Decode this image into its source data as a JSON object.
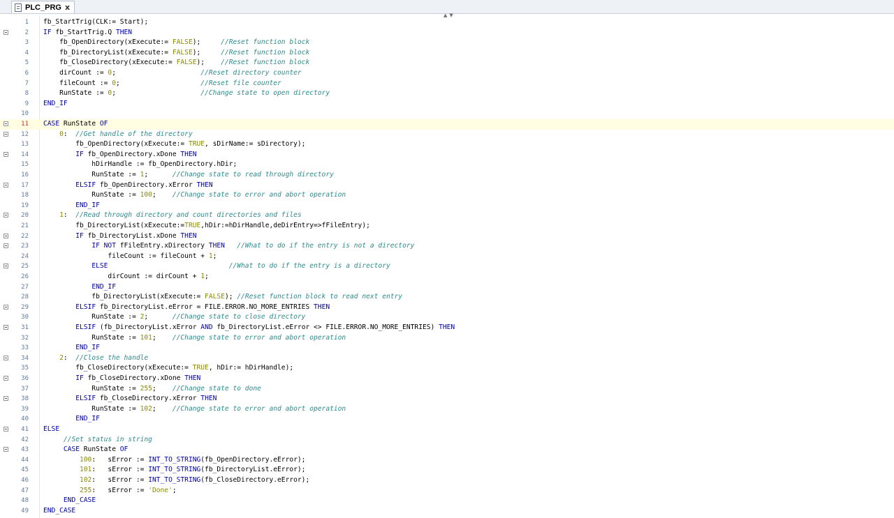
{
  "tab": {
    "label": "PLC_PRG",
    "close_label": "x"
  },
  "editor": {
    "active_line": 11,
    "lines": [
      {
        "n": "1",
        "fold": false,
        "tokens": [
          {
            "t": "fb_StartTrig(CLK:= Start);",
            "c": "txt"
          }
        ]
      },
      {
        "n": "2",
        "fold": true,
        "tokens": [
          {
            "t": "IF",
            "c": "kw"
          },
          {
            "t": " fb_StartTrig.Q ",
            "c": "txt"
          },
          {
            "t": "THEN",
            "c": "kw"
          }
        ]
      },
      {
        "n": "3",
        "fold": false,
        "tokens": [
          {
            "t": "    fb_OpenDirectory(xExecute:= ",
            "c": "txt"
          },
          {
            "t": "FALSE",
            "c": "num"
          },
          {
            "t": ");     ",
            "c": "txt"
          },
          {
            "t": "//Reset function block",
            "c": "cmt"
          }
        ]
      },
      {
        "n": "4",
        "fold": false,
        "tokens": [
          {
            "t": "    fb_DirectoryList(xExecute:= ",
            "c": "txt"
          },
          {
            "t": "FALSE",
            "c": "num"
          },
          {
            "t": ");     ",
            "c": "txt"
          },
          {
            "t": "//Reset function block",
            "c": "cmt"
          }
        ]
      },
      {
        "n": "5",
        "fold": false,
        "tokens": [
          {
            "t": "    fb_CloseDirectory(xExecute:= ",
            "c": "txt"
          },
          {
            "t": "FALSE",
            "c": "num"
          },
          {
            "t": ");    ",
            "c": "txt"
          },
          {
            "t": "//Reset function block",
            "c": "cmt"
          }
        ]
      },
      {
        "n": "6",
        "fold": false,
        "tokens": [
          {
            "t": "    dirCount := ",
            "c": "txt"
          },
          {
            "t": "0",
            "c": "num"
          },
          {
            "t": ";                     ",
            "c": "txt"
          },
          {
            "t": "//Reset directory counter",
            "c": "cmt"
          }
        ]
      },
      {
        "n": "7",
        "fold": false,
        "tokens": [
          {
            "t": "    fileCount := ",
            "c": "txt"
          },
          {
            "t": "0",
            "c": "num"
          },
          {
            "t": ";                    ",
            "c": "txt"
          },
          {
            "t": "//Reset file counter",
            "c": "cmt"
          }
        ]
      },
      {
        "n": "8",
        "fold": false,
        "tokens": [
          {
            "t": "    RunState := ",
            "c": "txt"
          },
          {
            "t": "0",
            "c": "num"
          },
          {
            "t": ";                     ",
            "c": "txt"
          },
          {
            "t": "//Change state to open directory",
            "c": "cmt"
          }
        ]
      },
      {
        "n": "9",
        "fold": false,
        "tokens": [
          {
            "t": "END_IF",
            "c": "kw"
          }
        ]
      },
      {
        "n": "10",
        "fold": false,
        "tokens": []
      },
      {
        "n": "11",
        "fold": true,
        "tokens": [
          {
            "t": "CASE",
            "c": "kw"
          },
          {
            "t": " RunState ",
            "c": "txt"
          },
          {
            "t": "OF",
            "c": "kw"
          }
        ]
      },
      {
        "n": "12",
        "fold": true,
        "tokens": [
          {
            "t": "    ",
            "c": "txt"
          },
          {
            "t": "0",
            "c": "num"
          },
          {
            "t": ":  ",
            "c": "txt"
          },
          {
            "t": "//Get handle of the directory",
            "c": "cmt"
          }
        ]
      },
      {
        "n": "13",
        "fold": false,
        "tokens": [
          {
            "t": "        fb_OpenDirectory(xExecute:= ",
            "c": "txt"
          },
          {
            "t": "TRUE",
            "c": "num"
          },
          {
            "t": ", sDirName:= sDirectory);",
            "c": "txt"
          }
        ]
      },
      {
        "n": "14",
        "fold": true,
        "tokens": [
          {
            "t": "        ",
            "c": "txt"
          },
          {
            "t": "IF",
            "c": "kw"
          },
          {
            "t": " fb_OpenDirectory.xDone ",
            "c": "txt"
          },
          {
            "t": "THEN",
            "c": "kw"
          }
        ]
      },
      {
        "n": "15",
        "fold": false,
        "tokens": [
          {
            "t": "            hDirHandle := fb_OpenDirectory.hDir;",
            "c": "txt"
          }
        ]
      },
      {
        "n": "16",
        "fold": false,
        "tokens": [
          {
            "t": "            RunState := ",
            "c": "txt"
          },
          {
            "t": "1",
            "c": "num"
          },
          {
            "t": ";      ",
            "c": "txt"
          },
          {
            "t": "//Change state to read through directory",
            "c": "cmt"
          }
        ]
      },
      {
        "n": "17",
        "fold": true,
        "tokens": [
          {
            "t": "        ",
            "c": "txt"
          },
          {
            "t": "ELSIF",
            "c": "kw"
          },
          {
            "t": " fb_OpenDirectory.xError ",
            "c": "txt"
          },
          {
            "t": "THEN",
            "c": "kw"
          }
        ]
      },
      {
        "n": "18",
        "fold": false,
        "tokens": [
          {
            "t": "            RunState := ",
            "c": "txt"
          },
          {
            "t": "100",
            "c": "num"
          },
          {
            "t": ";    ",
            "c": "txt"
          },
          {
            "t": "//Change state to error and abort operation",
            "c": "cmt"
          }
        ]
      },
      {
        "n": "19",
        "fold": false,
        "tokens": [
          {
            "t": "        ",
            "c": "txt"
          },
          {
            "t": "END_IF",
            "c": "kw"
          }
        ]
      },
      {
        "n": "20",
        "fold": true,
        "tokens": [
          {
            "t": "    ",
            "c": "txt"
          },
          {
            "t": "1",
            "c": "num"
          },
          {
            "t": ":  ",
            "c": "txt"
          },
          {
            "t": "//Read through directory and count directories and files",
            "c": "cmt"
          }
        ]
      },
      {
        "n": "21",
        "fold": false,
        "tokens": [
          {
            "t": "        fb_DirectoryList(xExecute:=",
            "c": "txt"
          },
          {
            "t": "TRUE",
            "c": "num"
          },
          {
            "t": ",hDir:=hDirHandle,deDirEntry=>fFileEntry);",
            "c": "txt"
          }
        ]
      },
      {
        "n": "22",
        "fold": true,
        "tokens": [
          {
            "t": "        ",
            "c": "txt"
          },
          {
            "t": "IF",
            "c": "kw"
          },
          {
            "t": " fb_DirectoryList.xDone ",
            "c": "txt"
          },
          {
            "t": "THEN",
            "c": "kw"
          }
        ]
      },
      {
        "n": "23",
        "fold": true,
        "tokens": [
          {
            "t": "            ",
            "c": "txt"
          },
          {
            "t": "IF NOT",
            "c": "kw"
          },
          {
            "t": " fFileEntry.xDirectory ",
            "c": "txt"
          },
          {
            "t": "THEN",
            "c": "kw"
          },
          {
            "t": "   ",
            "c": "txt"
          },
          {
            "t": "//What to do if the entry is not a directory",
            "c": "cmt"
          }
        ]
      },
      {
        "n": "24",
        "fold": false,
        "tokens": [
          {
            "t": "                fileCount := fileCount + ",
            "c": "txt"
          },
          {
            "t": "1",
            "c": "num"
          },
          {
            "t": ";",
            "c": "txt"
          }
        ]
      },
      {
        "n": "25",
        "fold": true,
        "tokens": [
          {
            "t": "            ",
            "c": "txt"
          },
          {
            "t": "ELSE",
            "c": "kw"
          },
          {
            "t": "                              ",
            "c": "txt"
          },
          {
            "t": "//What to do if the entry is a directory",
            "c": "cmt"
          }
        ]
      },
      {
        "n": "26",
        "fold": false,
        "tokens": [
          {
            "t": "                dirCount := dirCount + ",
            "c": "txt"
          },
          {
            "t": "1",
            "c": "num"
          },
          {
            "t": ";",
            "c": "txt"
          }
        ]
      },
      {
        "n": "27",
        "fold": false,
        "tokens": [
          {
            "t": "            ",
            "c": "txt"
          },
          {
            "t": "END_IF",
            "c": "kw"
          }
        ]
      },
      {
        "n": "28",
        "fold": false,
        "tokens": [
          {
            "t": "            fb_DirectoryList(xExecute:= ",
            "c": "txt"
          },
          {
            "t": "FALSE",
            "c": "num"
          },
          {
            "t": "); ",
            "c": "txt"
          },
          {
            "t": "//Reset function block to read next entry",
            "c": "cmt"
          }
        ]
      },
      {
        "n": "29",
        "fold": true,
        "tokens": [
          {
            "t": "        ",
            "c": "txt"
          },
          {
            "t": "ELSIF",
            "c": "kw"
          },
          {
            "t": " fb_DirectoryList.eError = FILE.ERROR.NO_MORE_ENTRIES ",
            "c": "txt"
          },
          {
            "t": "THEN",
            "c": "kw"
          }
        ]
      },
      {
        "n": "30",
        "fold": false,
        "tokens": [
          {
            "t": "            RunState := ",
            "c": "txt"
          },
          {
            "t": "2",
            "c": "num"
          },
          {
            "t": ";      ",
            "c": "txt"
          },
          {
            "t": "//Change state to close directory",
            "c": "cmt"
          }
        ]
      },
      {
        "n": "31",
        "fold": true,
        "tokens": [
          {
            "t": "        ",
            "c": "txt"
          },
          {
            "t": "ELSIF",
            "c": "kw"
          },
          {
            "t": " (fb_DirectoryList.xError ",
            "c": "txt"
          },
          {
            "t": "AND",
            "c": "kw"
          },
          {
            "t": " fb_DirectoryList.eError <> FILE.ERROR.NO_MORE_ENTRIES) ",
            "c": "txt"
          },
          {
            "t": "THEN",
            "c": "kw"
          }
        ]
      },
      {
        "n": "32",
        "fold": false,
        "tokens": [
          {
            "t": "            RunState := ",
            "c": "txt"
          },
          {
            "t": "101",
            "c": "num"
          },
          {
            "t": ";    ",
            "c": "txt"
          },
          {
            "t": "//Change state to error and abort operation",
            "c": "cmt"
          }
        ]
      },
      {
        "n": "33",
        "fold": false,
        "tokens": [
          {
            "t": "        ",
            "c": "txt"
          },
          {
            "t": "END_IF",
            "c": "kw"
          }
        ]
      },
      {
        "n": "34",
        "fold": true,
        "tokens": [
          {
            "t": "    ",
            "c": "txt"
          },
          {
            "t": "2",
            "c": "num"
          },
          {
            "t": ":  ",
            "c": "txt"
          },
          {
            "t": "//Close the handle",
            "c": "cmt"
          }
        ]
      },
      {
        "n": "35",
        "fold": false,
        "tokens": [
          {
            "t": "        fb_CloseDirectory(xExecute:= ",
            "c": "txt"
          },
          {
            "t": "TRUE",
            "c": "num"
          },
          {
            "t": ", hDir:= hDirHandle);",
            "c": "txt"
          }
        ]
      },
      {
        "n": "36",
        "fold": true,
        "tokens": [
          {
            "t": "        ",
            "c": "txt"
          },
          {
            "t": "IF",
            "c": "kw"
          },
          {
            "t": " fb_CloseDirectory.xDone ",
            "c": "txt"
          },
          {
            "t": "THEN",
            "c": "kw"
          }
        ]
      },
      {
        "n": "37",
        "fold": false,
        "tokens": [
          {
            "t": "            RunState := ",
            "c": "txt"
          },
          {
            "t": "255",
            "c": "num"
          },
          {
            "t": ";    ",
            "c": "txt"
          },
          {
            "t": "//Change state to done",
            "c": "cmt"
          }
        ]
      },
      {
        "n": "38",
        "fold": true,
        "tokens": [
          {
            "t": "        ",
            "c": "txt"
          },
          {
            "t": "ELSIF",
            "c": "kw"
          },
          {
            "t": " fb_CloseDirectory.xError ",
            "c": "txt"
          },
          {
            "t": "THEN",
            "c": "kw"
          }
        ]
      },
      {
        "n": "39",
        "fold": false,
        "tokens": [
          {
            "t": "            RunState := ",
            "c": "txt"
          },
          {
            "t": "102",
            "c": "num"
          },
          {
            "t": ";    ",
            "c": "txt"
          },
          {
            "t": "//Change state to error and abort operation",
            "c": "cmt"
          }
        ]
      },
      {
        "n": "40",
        "fold": false,
        "tokens": [
          {
            "t": "        ",
            "c": "txt"
          },
          {
            "t": "END_IF",
            "c": "kw"
          }
        ]
      },
      {
        "n": "41",
        "fold": true,
        "tokens": [
          {
            "t": "ELSE",
            "c": "kw"
          }
        ]
      },
      {
        "n": "42",
        "fold": false,
        "tokens": [
          {
            "t": "     ",
            "c": "txt"
          },
          {
            "t": "//Set status in string",
            "c": "cmt"
          }
        ]
      },
      {
        "n": "43",
        "fold": true,
        "tokens": [
          {
            "t": "     ",
            "c": "txt"
          },
          {
            "t": "CASE",
            "c": "kw"
          },
          {
            "t": " RunState ",
            "c": "txt"
          },
          {
            "t": "OF",
            "c": "kw"
          }
        ]
      },
      {
        "n": "44",
        "fold": false,
        "tokens": [
          {
            "t": "         ",
            "c": "txt"
          },
          {
            "t": "100",
            "c": "num"
          },
          {
            "t": ":   sError := ",
            "c": "txt"
          },
          {
            "t": "INT_TO_STRING",
            "c": "kw"
          },
          {
            "t": "(fb_OpenDirectory.eError);",
            "c": "txt"
          }
        ]
      },
      {
        "n": "45",
        "fold": false,
        "tokens": [
          {
            "t": "         ",
            "c": "txt"
          },
          {
            "t": "101",
            "c": "num"
          },
          {
            "t": ":   sError := ",
            "c": "txt"
          },
          {
            "t": "INT_TO_STRING",
            "c": "kw"
          },
          {
            "t": "(fb_DirectoryList.eError);",
            "c": "txt"
          }
        ]
      },
      {
        "n": "46",
        "fold": false,
        "tokens": [
          {
            "t": "         ",
            "c": "txt"
          },
          {
            "t": "102",
            "c": "num"
          },
          {
            "t": ":   sError := ",
            "c": "txt"
          },
          {
            "t": "INT_TO_STRING",
            "c": "kw"
          },
          {
            "t": "(fb_CloseDirectory.eError);",
            "c": "txt"
          }
        ]
      },
      {
        "n": "47",
        "fold": false,
        "tokens": [
          {
            "t": "         ",
            "c": "txt"
          },
          {
            "t": "255",
            "c": "num"
          },
          {
            "t": ":   sError := ",
            "c": "txt"
          },
          {
            "t": "'Done'",
            "c": "str"
          },
          {
            "t": ";",
            "c": "txt"
          }
        ]
      },
      {
        "n": "48",
        "fold": false,
        "tokens": [
          {
            "t": "     ",
            "c": "txt"
          },
          {
            "t": "END_CASE",
            "c": "kw"
          }
        ]
      },
      {
        "n": "49",
        "fold": false,
        "tokens": [
          {
            "t": "END_CASE",
            "c": "kw"
          }
        ]
      }
    ]
  }
}
